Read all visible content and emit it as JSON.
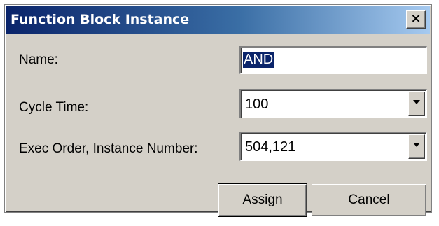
{
  "window": {
    "title": "Function Block Instance",
    "close_symbol": "×"
  },
  "fields": {
    "name": {
      "label": "Name:",
      "value": "AND"
    },
    "cycle_time": {
      "label": "Cycle Time:",
      "value": "100"
    },
    "exec_order": {
      "label": "Exec Order, Instance Number:",
      "value": "504,121"
    }
  },
  "buttons": {
    "assign_label": "Assign",
    "cancel_label": "Cancel"
  },
  "icons": {
    "close": "close-icon",
    "dropdown": "chevron-down-icon"
  },
  "colors": {
    "titlebar_start": "#0a246a",
    "titlebar_end": "#a6caf0",
    "dialog_face": "#d4d0c8",
    "selection": "#0a246a"
  }
}
